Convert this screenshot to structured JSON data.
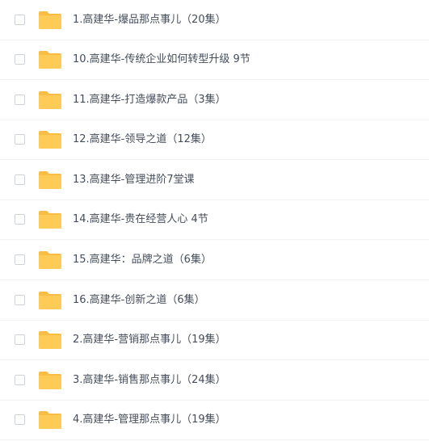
{
  "colors": {
    "folder": "#ffcb57",
    "folder_tab": "#f7bd45",
    "text": "#454d5a",
    "row_divider": "#f1f2f4",
    "checkbox_border": "#cfd3d9"
  },
  "files": [
    {
      "name": "1.高建华-爆品那点事儿（20集）",
      "icon": "folder-icon"
    },
    {
      "name": "10.高建华-传统企业如何转型升级 9节",
      "icon": "folder-icon"
    },
    {
      "name": "11.高建华-打造爆款产品（3集）",
      "icon": "folder-icon"
    },
    {
      "name": "12.高建华-领导之道（12集）",
      "icon": "folder-icon"
    },
    {
      "name": "13.高建华-管理进阶7堂课",
      "icon": "folder-icon"
    },
    {
      "name": "14.高建华-贵在经营人心 4节",
      "icon": "folder-icon"
    },
    {
      "name": "15.高建华：品牌之道（6集）",
      "icon": "folder-icon"
    },
    {
      "name": "16.高建华-创新之道（6集）",
      "icon": "folder-icon"
    },
    {
      "name": "2.高建华-营销那点事儿（19集）",
      "icon": "folder-icon"
    },
    {
      "name": "3.高建华-销售那点事儿（24集）",
      "icon": "folder-icon"
    },
    {
      "name": "4.高建华-管理那点事儿（19集）",
      "icon": "folder-icon"
    }
  ]
}
